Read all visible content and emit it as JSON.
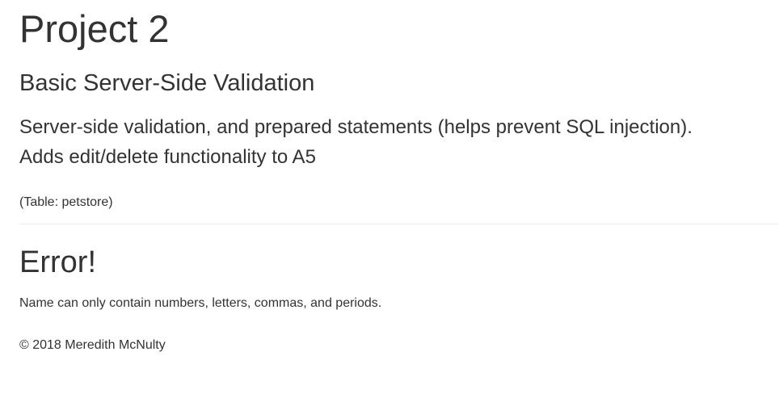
{
  "header": {
    "title": "Project 2",
    "subtitle": "Basic Server-Side Validation",
    "description_line1": "Server-side validation, and prepared statements (helps prevent SQL injection).",
    "description_line2": "Adds edit/delete functionality to A5",
    "table_note": "(Table: petstore)"
  },
  "error": {
    "heading": "Error!",
    "message": "Name can only contain numbers, letters, commas, and periods."
  },
  "footer": {
    "copyright": "© 2018 Meredith McNulty"
  },
  "colors": {
    "text": "#333333",
    "divider": "#eeeeee",
    "background": "#ffffff"
  }
}
